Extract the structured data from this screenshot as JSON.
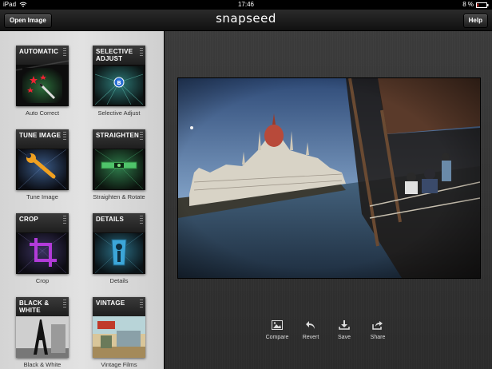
{
  "status_bar": {
    "device": "iPad",
    "time": "17:46",
    "battery": "8 %"
  },
  "toolbar": {
    "open_label": "Open Image",
    "app_title": "snapseed",
    "help_label": "Help"
  },
  "tools": [
    {
      "title": "AUTOMATIC",
      "label": "Auto Correct",
      "icon": "magic-wand-icon"
    },
    {
      "title": "SELECTIVE ADJUST",
      "label": "Selective Adjust",
      "icon": "control-point-icon"
    },
    {
      "title": "TUNE IMAGE",
      "label": "Tune Image",
      "icon": "wrench-icon"
    },
    {
      "title": "STRAIGHTEN",
      "label": "Straighten & Rotate",
      "icon": "level-icon"
    },
    {
      "title": "CROP",
      "label": "Crop",
      "icon": "crop-icon"
    },
    {
      "title": "DETAILS",
      "label": "Details",
      "icon": "sharpener-icon"
    },
    {
      "title": "BLACK & WHITE",
      "label": "Black & White",
      "icon": "eiffel-tower-icon"
    },
    {
      "title": "VINTAGE",
      "label": "Vintage Films",
      "icon": "vintage-photo-icon"
    }
  ],
  "actions": {
    "compare": "Compare",
    "revert": "Revert",
    "save": "Save",
    "share": "Share"
  }
}
